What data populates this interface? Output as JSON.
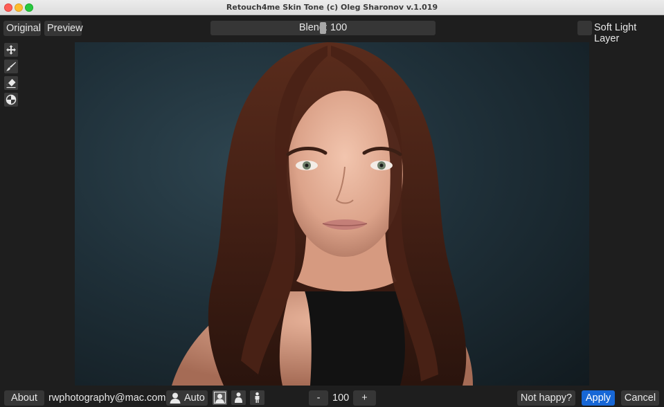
{
  "window": {
    "title": "Retouch4me Skin Tone (c) Oleg Sharonov v.1.019"
  },
  "top_toolbar": {
    "original_label": "Original",
    "preview_label": "Preview",
    "blend_label": "Blend: 100",
    "blend_value": 100,
    "soft_light_label": "Soft Light Layer",
    "soft_light_checked": false
  },
  "tools": [
    {
      "name": "move-icon"
    },
    {
      "name": "brush-icon"
    },
    {
      "name": "eraser-icon"
    },
    {
      "name": "color-picker-icon"
    }
  ],
  "bottom_toolbar": {
    "about_label": "About",
    "email": "rwphotography@mac.com",
    "auto_label": "Auto",
    "minus_label": "-",
    "amount_value": "100",
    "plus_label": "+",
    "not_happy_label": "Not happy?",
    "apply_label": "Apply",
    "cancel_label": "Cancel"
  },
  "colors": {
    "background": "#1e1e1e",
    "button": "#363636",
    "accent": "#1767d6"
  }
}
